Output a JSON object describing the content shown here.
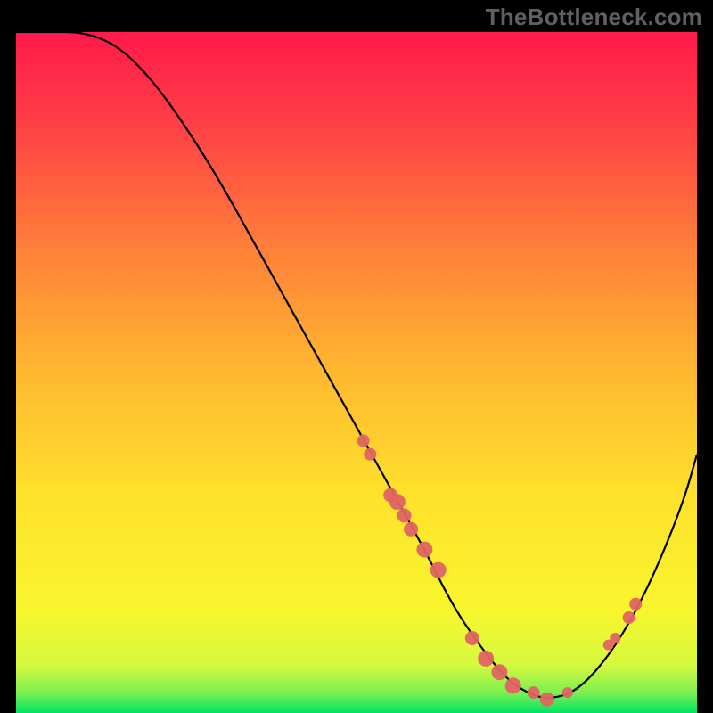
{
  "watermark": "TheBottleneck.com",
  "colors": {
    "gradient_top": "#ff1a4b",
    "gradient_mid": "#ffdf2a",
    "gradient_bottom": "#00e467",
    "curve": "#000000",
    "point": "#e06464"
  },
  "chart_data": {
    "type": "line",
    "title": "",
    "xlabel": "",
    "ylabel": "",
    "xlim": [
      0,
      100
    ],
    "ylim": [
      0,
      100
    ],
    "series": [
      {
        "name": "bottleneck-curve",
        "x": [
          0,
          5,
          10,
          15,
          20,
          25,
          30,
          35,
          40,
          45,
          50,
          55,
          60,
          64,
          68,
          72,
          75,
          78,
          82,
          86,
          90,
          94,
          98,
          100
        ],
        "y": [
          100,
          100,
          100,
          98,
          93,
          86,
          78,
          69,
          60,
          51,
          42,
          33,
          24,
          16,
          10,
          5,
          3,
          2,
          3,
          7,
          13,
          21,
          31,
          38
        ]
      }
    ],
    "markers": {
      "x": [
        51,
        52,
        55,
        56,
        57,
        58,
        60,
        62,
        67,
        69,
        71,
        73,
        76,
        78,
        81,
        87,
        88,
        90,
        91
      ],
      "y": [
        40,
        38,
        32,
        31,
        29,
        27,
        24,
        21,
        11,
        8,
        6,
        4,
        3,
        2,
        3,
        10,
        11,
        14,
        16
      ],
      "r": [
        7,
        7,
        8,
        9,
        8,
        8,
        9,
        9,
        8,
        9,
        9,
        9,
        7,
        8,
        6,
        6,
        6,
        7,
        7
      ]
    }
  }
}
